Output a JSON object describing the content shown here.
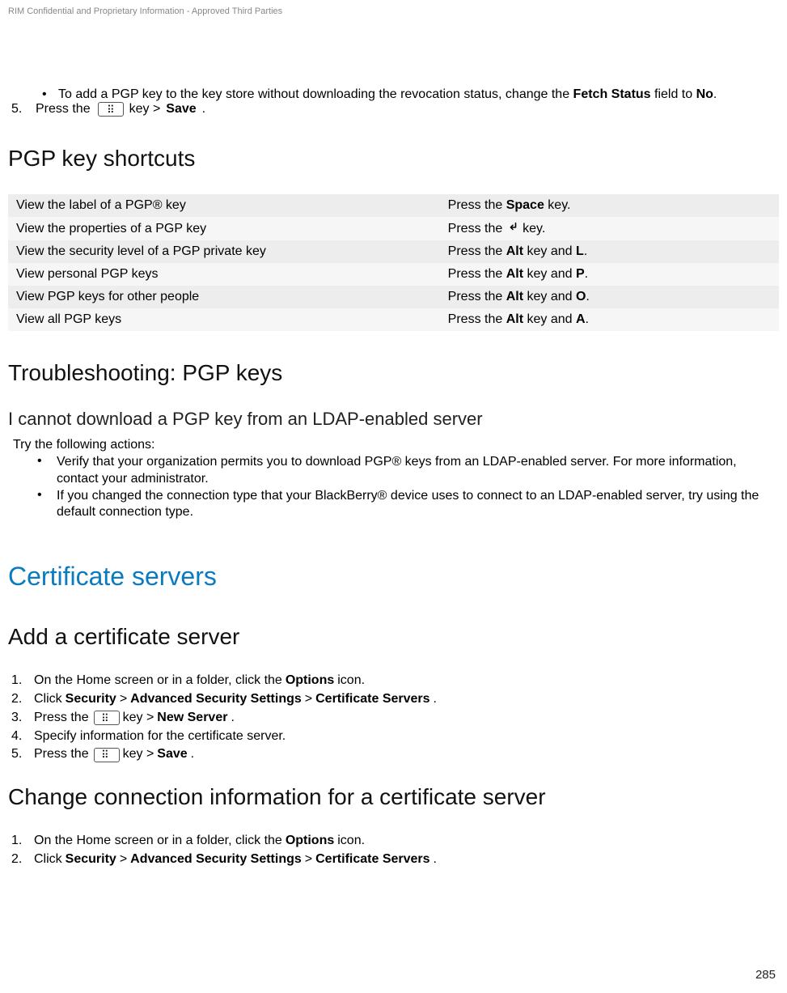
{
  "header": "RIM Confidential and Proprietary Information - Approved Third Parties",
  "intro": {
    "bullet_pre": "To add a PGP key to the key store without downloading the revocation status, change the ",
    "bullet_bold": "Fetch Status",
    "bullet_post": " field to ",
    "bullet_no": "No",
    "bullet_end": ".",
    "step5_num": "5.",
    "step5_pre": "Press the ",
    "step5_mid": " key > ",
    "step5_save": "Save",
    "step5_end": "."
  },
  "pgp_shortcuts_heading": "PGP key shortcuts",
  "shortcuts": [
    {
      "left": "View the label of a PGP® key",
      "right_pre": "Press the ",
      "right_b1": "Space",
      "right_mid": " key.",
      "right_b2": "",
      "right_end": "",
      "icon": false
    },
    {
      "left": "View the properties of a PGP key",
      "right_pre": "Press the ",
      "right_b1": "",
      "right_mid": " key.",
      "right_b2": "",
      "right_end": "",
      "icon": true
    },
    {
      "left": "View the security level of a PGP private key",
      "right_pre": "Press the ",
      "right_b1": "Alt",
      "right_mid": " key and ",
      "right_b2": "L",
      "right_end": ".",
      "icon": false
    },
    {
      "left": "View personal PGP keys",
      "right_pre": "Press the ",
      "right_b1": "Alt",
      "right_mid": " key and ",
      "right_b2": "P",
      "right_end": ".",
      "icon": false
    },
    {
      "left": "View PGP keys for other people",
      "right_pre": "Press the ",
      "right_b1": "Alt",
      "right_mid": " key and ",
      "right_b2": "O",
      "right_end": ".",
      "icon": false
    },
    {
      "left": "View all PGP keys",
      "right_pre": "Press the ",
      "right_b1": "Alt",
      "right_mid": " key and ",
      "right_b2": "A",
      "right_end": ".",
      "icon": false
    }
  ],
  "troubleshooting_heading": "Troubleshooting: PGP keys",
  "troubleshooting_sub": "I cannot download a PGP key from an LDAP-enabled server",
  "try_following": "Try the following actions:",
  "ts_items": [
    "Verify that your organization permits you to download PGP® keys from an LDAP-enabled server. For more information, contact your administrator.",
    "If you changed the connection type that your BlackBerry® device uses to connect to an LDAP-enabled server, try using the default connection type."
  ],
  "cert_heading": "Certificate servers",
  "add_cert_heading": "Add a certificate server",
  "add_steps": {
    "s1_num": "1.",
    "s1_pre": "On the Home screen or in a folder, click the ",
    "s1_b": "Options",
    "s1_end": " icon.",
    "s2_num": "2.",
    "s2_pre": "Click ",
    "s2_b1": "Security",
    "s2_g1": " > ",
    "s2_b2": "Advanced Security Settings",
    "s2_g2": " > ",
    "s2_b3": "Certificate Servers",
    "s2_end": ".",
    "s3_num": "3.",
    "s3_pre": "Press the ",
    "s3_mid": " key > ",
    "s3_b": "New Server",
    "s3_end": ".",
    "s4_num": "4.",
    "s4_txt": "Specify information for the certificate server.",
    "s5_num": "5.",
    "s5_pre": "Press the ",
    "s5_mid": " key > ",
    "s5_b": "Save",
    "s5_end": "."
  },
  "change_conn_heading": "Change connection information for a certificate server",
  "change_steps": {
    "s1_num": "1.",
    "s1_pre": "On the Home screen or in a folder, click the ",
    "s1_b": "Options",
    "s1_end": " icon.",
    "s2_num": "2.",
    "s2_pre": "Click ",
    "s2_b1": "Security",
    "s2_g1": " > ",
    "s2_b2": "Advanced Security Settings",
    "s2_g2": " > ",
    "s2_b3": "Certificate Servers",
    "s2_end": "."
  },
  "page_number": "285"
}
